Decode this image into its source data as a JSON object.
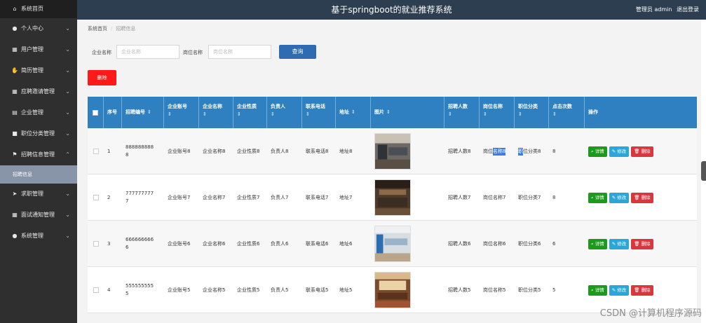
{
  "app": {
    "title": "基于springboot的就业推荐系统",
    "user": "管理员 admin",
    "logout": "退出登录"
  },
  "sidebar": {
    "home": "系统首页",
    "items": [
      {
        "label": "个人中心",
        "icon": "user-icon"
      },
      {
        "label": "用户管理",
        "icon": "grid-icon"
      },
      {
        "label": "简历管理",
        "icon": "thumb-icon"
      },
      {
        "label": "应聘邀请管理",
        "icon": "grid-icon"
      },
      {
        "label": "企业管理",
        "icon": "clipboard-icon"
      },
      {
        "label": "职位分类管理",
        "icon": "briefcase-icon"
      },
      {
        "label": "招聘信息管理",
        "icon": "flag-icon",
        "expanded": true
      }
    ],
    "sub_active": "招聘信息",
    "items2": [
      {
        "label": "求职管理",
        "icon": "send-icon"
      },
      {
        "label": "面试通知管理",
        "icon": "grid-icon"
      },
      {
        "label": "系统管理",
        "icon": "pin-icon"
      }
    ]
  },
  "breadcrumb": {
    "root": "系统首页",
    "current": "招聘信息"
  },
  "filter": {
    "company_label": "企业名称",
    "company_placeholder": "企业名称",
    "job_label": "岗位名称",
    "job_placeholder": "岗位名称",
    "search_button": "查询"
  },
  "delete_button": "删除",
  "table": {
    "headers": {
      "index": "序号",
      "code": "招聘编号",
      "account": "企业账号",
      "company": "企业名称",
      "nature": "企业性质",
      "manager": "负责人",
      "phone": "联系电话",
      "address": "地址",
      "image": "图片",
      "count": "招聘人数",
      "job": "岗位名称",
      "category": "职位分类",
      "clicks": "点击次数",
      "actions": "操作"
    },
    "sort_glyph": "⇕",
    "actions": {
      "detail": "详情",
      "edit": "修改",
      "delete": "删除"
    },
    "rows": [
      {
        "index": "1",
        "code": "888888888",
        "code2": "8",
        "account": "企业账号8",
        "company": "企业名称8",
        "nature": "企业性质8",
        "manager": "负责人8",
        "phone": "联系电话8",
        "address": "地址8",
        "count": "招聘人数8",
        "job_a": "岗位",
        "job_b": "名称8",
        "cat_a": "职",
        "cat_b": "位分类8",
        "clicks": "8"
      },
      {
        "index": "2",
        "code": "777777777",
        "code2": "7",
        "account": "企业账号7",
        "company": "企业名称7",
        "nature": "企业性质7",
        "manager": "负责人7",
        "phone": "联系电话7",
        "address": "地址7",
        "count": "招聘人数7",
        "job": "岗位名称7",
        "category": "职位分类7",
        "clicks": "8"
      },
      {
        "index": "3",
        "code": "666666666",
        "code2": "6",
        "account": "企业账号6",
        "company": "企业名称6",
        "nature": "企业性质6",
        "manager": "负责人6",
        "phone": "联系电话6",
        "address": "地址6",
        "count": "招聘人数6",
        "job": "岗位名称6",
        "category": "职位分类6",
        "clicks": "6"
      },
      {
        "index": "4",
        "code": "555555555",
        "code2": "5",
        "account": "企业账号5",
        "company": "企业名称5",
        "nature": "企业性质5",
        "manager": "负责人5",
        "phone": "联系电话5",
        "address": "地址5",
        "count": "招聘人数5",
        "job": "岗位名称5",
        "category": "职位分类5",
        "clicks": "5"
      }
    ]
  },
  "watermark": "CSDN @计算机程序源码",
  "colors": {
    "topbar": "#2c3e50",
    "sidebar": "#2f2f2f",
    "table_header": "#2f80c1",
    "search": "#2e6bb3",
    "delete": "#ff1a1a"
  }
}
